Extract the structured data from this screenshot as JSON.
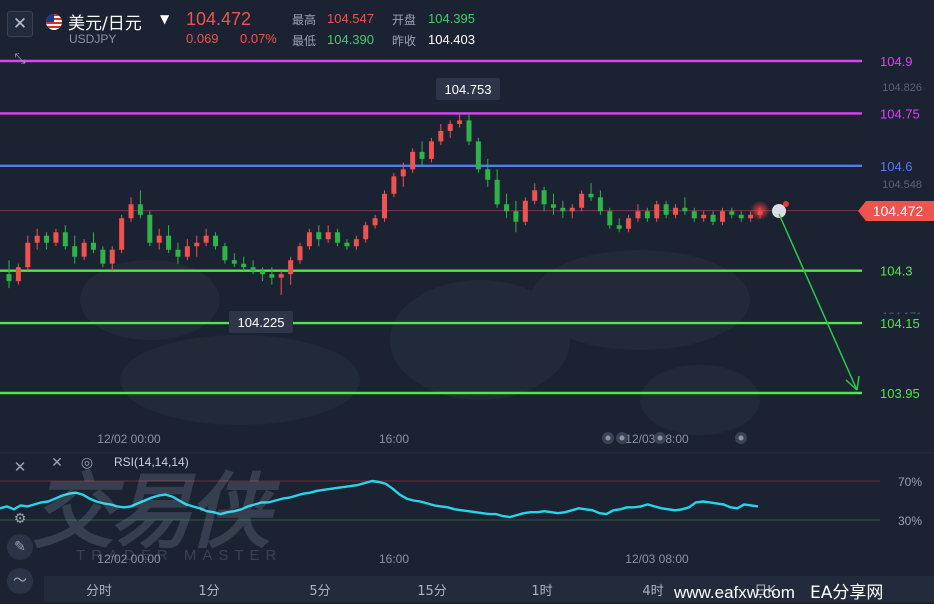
{
  "header": {
    "close_icon": "close-icon",
    "symbol_name": "美元/日元",
    "symbol_code": "USDJPY",
    "price": "104.472",
    "change": "0.069",
    "change_pct": "0.07%",
    "high_label": "最高",
    "high": "104.547",
    "low_label": "最低",
    "low": "104.390",
    "open_label": "开盘",
    "open": "104.395",
    "prev_close_label": "昨收",
    "prev_close": "104.403"
  },
  "colors": {
    "up": "#ef5350",
    "down": "#26a69a",
    "green_candle": "#2fb44a",
    "magenta": "#e040fb",
    "blue": "#4f7df5",
    "green_line": "#57e34e",
    "rsi": "#26d6e8"
  },
  "price_scale": {
    "axis_labels": [
      "104.826",
      "104.548",
      "104.171"
    ]
  },
  "horizontal_levels": [
    {
      "label": "104.9",
      "color": "#e040fb"
    },
    {
      "label": "104.75",
      "color": "#e040fb"
    },
    {
      "label": "104.6",
      "color": "#4f7df5"
    },
    {
      "label": "104.3",
      "color": "#57e34e"
    },
    {
      "label": "104.15",
      "color": "#57e34e"
    },
    {
      "label": "103.95",
      "color": "#57e34e"
    }
  ],
  "current_price_tag": "104.472",
  "annotations": {
    "high_marker": "104.753",
    "low_marker": "104.225"
  },
  "time_axis": [
    "12/02 00:00",
    "16:00",
    "12/03 08:00"
  ],
  "rsi": {
    "title": "RSI(14,14,14)",
    "level_70": "70%",
    "level_30": "30%",
    "values": [
      42,
      44,
      41,
      45,
      44,
      46,
      48,
      49,
      52,
      55,
      57,
      58,
      56,
      52,
      49,
      47,
      46,
      44,
      43,
      44,
      47,
      50,
      53,
      55,
      56,
      54,
      50,
      46,
      44,
      42,
      39,
      38,
      36,
      38,
      39,
      41,
      44,
      46,
      48,
      48,
      50,
      52,
      53,
      55,
      57,
      58,
      60,
      61,
      62,
      63,
      64,
      65,
      66,
      68,
      70,
      69,
      67,
      62,
      56,
      52,
      50,
      49,
      47,
      45,
      44,
      43,
      41,
      40,
      39,
      38,
      37,
      36,
      36,
      34,
      33,
      35,
      37,
      38,
      38,
      39,
      38,
      37,
      38,
      40,
      42,
      41,
      40,
      37,
      36,
      40,
      41,
      43,
      43,
      44,
      46,
      44,
      42,
      41,
      40,
      41,
      43,
      48,
      49,
      48,
      47,
      46,
      43,
      42,
      46,
      45,
      44
    ]
  },
  "timeframes": [
    "分时",
    "1分",
    "5分",
    "15分",
    "1时",
    "4时",
    "日K"
  ],
  "watermark": {
    "brand": "交易侠",
    "brand_en": "TRADER MASTER"
  },
  "footer_watermark": {
    "site": "www.eafxw.com",
    "name": "EA分享网"
  },
  "chart_data": {
    "type": "candlestick",
    "series": [
      {
        "o": 104.29,
        "h": 104.33,
        "l": 104.25,
        "c": 104.27
      },
      {
        "o": 104.27,
        "h": 104.32,
        "l": 104.26,
        "c": 104.31
      },
      {
        "o": 104.31,
        "h": 104.4,
        "l": 104.3,
        "c": 104.38
      },
      {
        "o": 104.38,
        "h": 104.42,
        "l": 104.36,
        "c": 104.4
      },
      {
        "o": 104.4,
        "h": 104.41,
        "l": 104.36,
        "c": 104.38
      },
      {
        "o": 104.38,
        "h": 104.42,
        "l": 104.37,
        "c": 104.41
      },
      {
        "o": 104.41,
        "h": 104.43,
        "l": 104.36,
        "c": 104.37
      },
      {
        "o": 104.37,
        "h": 104.4,
        "l": 104.32,
        "c": 104.34
      },
      {
        "o": 104.34,
        "h": 104.39,
        "l": 104.33,
        "c": 104.38
      },
      {
        "o": 104.38,
        "h": 104.41,
        "l": 104.35,
        "c": 104.36
      },
      {
        "o": 104.36,
        "h": 104.37,
        "l": 104.31,
        "c": 104.32
      },
      {
        "o": 104.32,
        "h": 104.37,
        "l": 104.3,
        "c": 104.36
      },
      {
        "o": 104.36,
        "h": 104.46,
        "l": 104.35,
        "c": 104.45
      },
      {
        "o": 104.45,
        "h": 104.51,
        "l": 104.44,
        "c": 104.49
      },
      {
        "o": 104.49,
        "h": 104.53,
        "l": 104.45,
        "c": 104.46
      },
      {
        "o": 104.46,
        "h": 104.47,
        "l": 104.37,
        "c": 104.38
      },
      {
        "o": 104.38,
        "h": 104.42,
        "l": 104.36,
        "c": 104.4
      },
      {
        "o": 104.4,
        "h": 104.43,
        "l": 104.35,
        "c": 104.36
      },
      {
        "o": 104.36,
        "h": 104.38,
        "l": 104.32,
        "c": 104.34
      },
      {
        "o": 104.34,
        "h": 104.39,
        "l": 104.33,
        "c": 104.37
      },
      {
        "o": 104.37,
        "h": 104.4,
        "l": 104.34,
        "c": 104.38
      },
      {
        "o": 104.38,
        "h": 104.42,
        "l": 104.37,
        "c": 104.4
      },
      {
        "o": 104.4,
        "h": 104.41,
        "l": 104.36,
        "c": 104.37
      },
      {
        "o": 104.37,
        "h": 104.38,
        "l": 104.32,
        "c": 104.33
      },
      {
        "o": 104.33,
        "h": 104.35,
        "l": 104.31,
        "c": 104.32
      },
      {
        "o": 104.32,
        "h": 104.34,
        "l": 104.3,
        "c": 104.31
      },
      {
        "o": 104.31,
        "h": 104.33,
        "l": 104.29,
        "c": 104.3
      },
      {
        "o": 104.3,
        "h": 104.31,
        "l": 104.27,
        "c": 104.29
      },
      {
        "o": 104.29,
        "h": 104.31,
        "l": 104.26,
        "c": 104.28
      },
      {
        "o": 104.28,
        "h": 104.3,
        "l": 104.23,
        "c": 104.29
      },
      {
        "o": 104.29,
        "h": 104.34,
        "l": 104.26,
        "c": 104.33
      },
      {
        "o": 104.33,
        "h": 104.38,
        "l": 104.32,
        "c": 104.37
      },
      {
        "o": 104.37,
        "h": 104.42,
        "l": 104.36,
        "c": 104.41
      },
      {
        "o": 104.41,
        "h": 104.43,
        "l": 104.37,
        "c": 104.39
      },
      {
        "o": 104.39,
        "h": 104.43,
        "l": 104.38,
        "c": 104.41
      },
      {
        "o": 104.41,
        "h": 104.42,
        "l": 104.37,
        "c": 104.38
      },
      {
        "o": 104.38,
        "h": 104.39,
        "l": 104.36,
        "c": 104.37
      },
      {
        "o": 104.37,
        "h": 104.4,
        "l": 104.36,
        "c": 104.39
      },
      {
        "o": 104.39,
        "h": 104.44,
        "l": 104.38,
        "c": 104.43
      },
      {
        "o": 104.43,
        "h": 104.46,
        "l": 104.42,
        "c": 104.45
      },
      {
        "o": 104.45,
        "h": 104.53,
        "l": 104.44,
        "c": 104.52
      },
      {
        "o": 104.52,
        "h": 104.58,
        "l": 104.51,
        "c": 104.57
      },
      {
        "o": 104.57,
        "h": 104.61,
        "l": 104.54,
        "c": 104.59
      },
      {
        "o": 104.59,
        "h": 104.65,
        "l": 104.58,
        "c": 104.64
      },
      {
        "o": 104.64,
        "h": 104.67,
        "l": 104.6,
        "c": 104.62
      },
      {
        "o": 104.62,
        "h": 104.68,
        "l": 104.61,
        "c": 104.67
      },
      {
        "o": 104.67,
        "h": 104.72,
        "l": 104.66,
        "c": 104.7
      },
      {
        "o": 104.7,
        "h": 104.73,
        "l": 104.68,
        "c": 104.72
      },
      {
        "o": 104.72,
        "h": 104.75,
        "l": 104.71,
        "c": 104.73
      },
      {
        "o": 104.73,
        "h": 104.75,
        "l": 104.66,
        "c": 104.67
      },
      {
        "o": 104.67,
        "h": 104.68,
        "l": 104.58,
        "c": 104.59
      },
      {
        "o": 104.59,
        "h": 104.62,
        "l": 104.54,
        "c": 104.56
      },
      {
        "o": 104.56,
        "h": 104.59,
        "l": 104.48,
        "c": 104.49
      },
      {
        "o": 104.49,
        "h": 104.52,
        "l": 104.45,
        "c": 104.47
      },
      {
        "o": 104.47,
        "h": 104.5,
        "l": 104.41,
        "c": 104.44
      },
      {
        "o": 104.44,
        "h": 104.51,
        "l": 104.43,
        "c": 104.5
      },
      {
        "o": 104.5,
        "h": 104.55,
        "l": 104.49,
        "c": 104.53
      },
      {
        "o": 104.53,
        "h": 104.54,
        "l": 104.47,
        "c": 104.49
      },
      {
        "o": 104.49,
        "h": 104.52,
        "l": 104.46,
        "c": 104.48
      },
      {
        "o": 104.48,
        "h": 104.5,
        "l": 104.45,
        "c": 104.47
      },
      {
        "o": 104.47,
        "h": 104.49,
        "l": 104.45,
        "c": 104.48
      },
      {
        "o": 104.48,
        "h": 104.53,
        "l": 104.47,
        "c": 104.52
      },
      {
        "o": 104.52,
        "h": 104.55,
        "l": 104.5,
        "c": 104.51
      },
      {
        "o": 104.51,
        "h": 104.53,
        "l": 104.46,
        "c": 104.47
      },
      {
        "o": 104.47,
        "h": 104.48,
        "l": 104.42,
        "c": 104.43
      },
      {
        "o": 104.43,
        "h": 104.45,
        "l": 104.41,
        "c": 104.42
      },
      {
        "o": 104.42,
        "h": 104.46,
        "l": 104.41,
        "c": 104.45
      },
      {
        "o": 104.45,
        "h": 104.49,
        "l": 104.44,
        "c": 104.47
      },
      {
        "o": 104.47,
        "h": 104.48,
        "l": 104.44,
        "c": 104.45
      },
      {
        "o": 104.45,
        "h": 104.5,
        "l": 104.44,
        "c": 104.49
      },
      {
        "o": 104.49,
        "h": 104.5,
        "l": 104.45,
        "c": 104.46
      },
      {
        "o": 104.46,
        "h": 104.49,
        "l": 104.45,
        "c": 104.48
      },
      {
        "o": 104.48,
        "h": 104.51,
        "l": 104.46,
        "c": 104.47
      },
      {
        "o": 104.47,
        "h": 104.48,
        "l": 104.44,
        "c": 104.45
      },
      {
        "o": 104.45,
        "h": 104.47,
        "l": 104.44,
        "c": 104.46
      },
      {
        "o": 104.46,
        "h": 104.47,
        "l": 104.43,
        "c": 104.44
      },
      {
        "o": 104.44,
        "h": 104.48,
        "l": 104.43,
        "c": 104.47
      },
      {
        "o": 104.47,
        "h": 104.48,
        "l": 104.45,
        "c": 104.46
      },
      {
        "o": 104.46,
        "h": 104.47,
        "l": 104.44,
        "c": 104.45
      },
      {
        "o": 104.45,
        "h": 104.47,
        "l": 104.44,
        "c": 104.46
      },
      {
        "o": 104.46,
        "h": 104.48,
        "l": 104.45,
        "c": 104.47
      }
    ]
  }
}
